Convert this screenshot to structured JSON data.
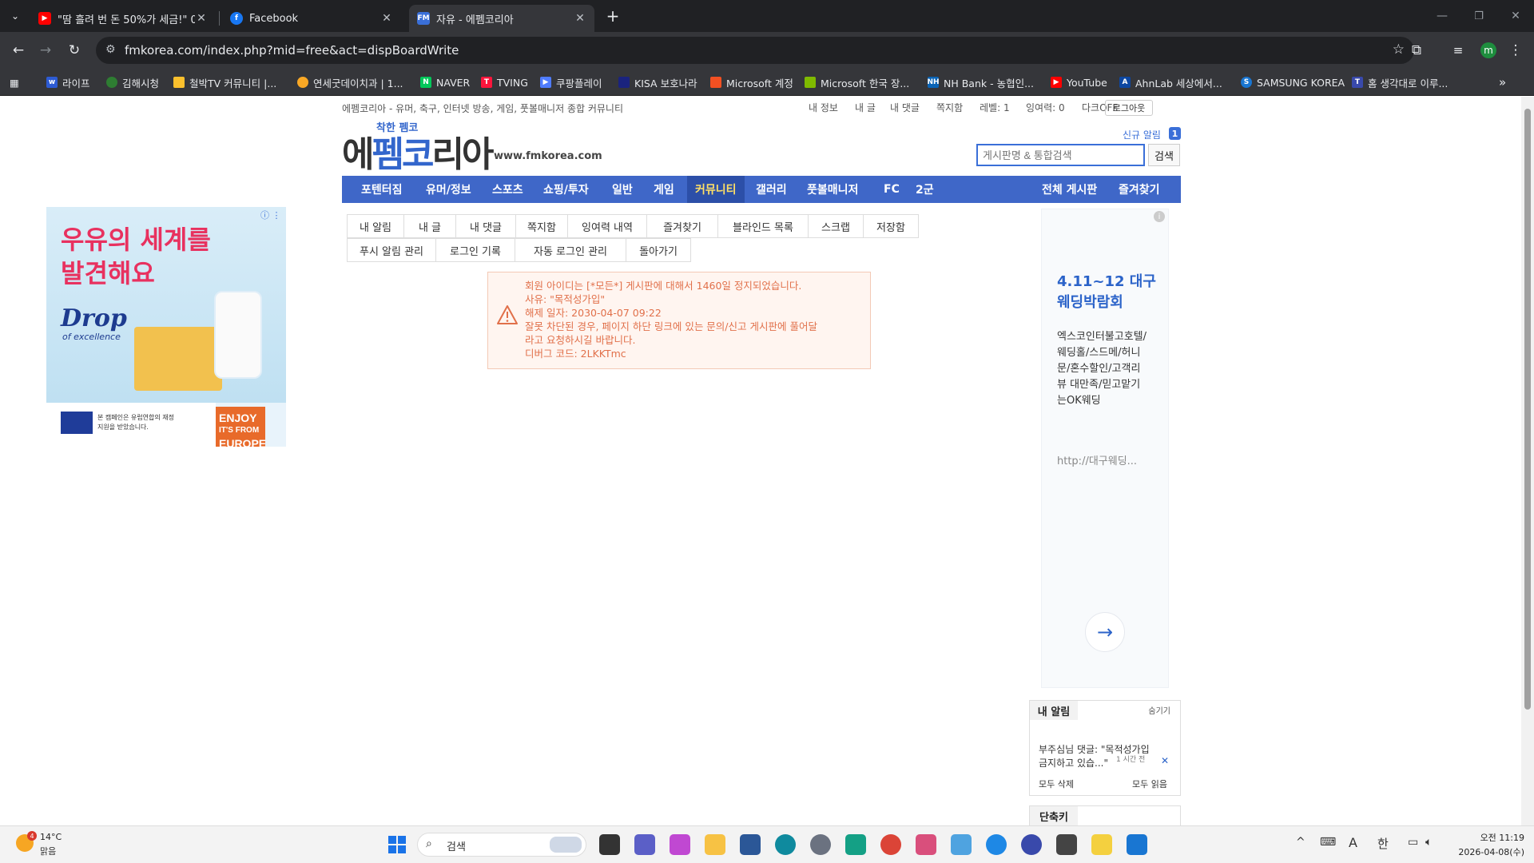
{
  "browser": {
    "tabs": [
      {
        "title": "\"땀 흘려 번 돈 50%가 세금!\" 0",
        "icon": "youtube-icon",
        "active": false
      },
      {
        "title": "Facebook",
        "icon": "facebook-icon",
        "active": false
      },
      {
        "title": "자유 - 에펨코리아",
        "icon": "fmkorea-icon",
        "active": true
      }
    ],
    "url": "fmkorea.com/index.php?mid=free&act=dispBoardWrite",
    "profile_initial": "m",
    "bookmarks": [
      {
        "label": "라이프",
        "color": "#2d5bd3"
      },
      {
        "label": "김해시청",
        "color": "#2e7d32"
      },
      {
        "label": "철박TV 커뮤니티 |...",
        "color": "#fbc02d"
      },
      {
        "label": "연세굿데이치과 | 1...",
        "color": "#f9a825"
      },
      {
        "label": "NAVER",
        "color": "#03c75a"
      },
      {
        "label": "TVING",
        "color": "#ff153c"
      },
      {
        "label": "쿠팡플레이",
        "color": "#4f7cff"
      },
      {
        "label": "KISA 보호나라",
        "color": "#1a237e"
      },
      {
        "label": "Microsoft 계정",
        "color": "#f25022"
      },
      {
        "label": "Microsoft 한국 장...",
        "color": "#7fba00"
      },
      {
        "label": "NH Bank - 농협인...",
        "color": "#0a64b6"
      },
      {
        "label": "YouTube",
        "color": "#ff0000"
      },
      {
        "label": "AhnLab 세상에서...",
        "color": "#0d47a1"
      },
      {
        "label": "SAMSUNG KOREA",
        "color": "#1976d2"
      },
      {
        "label": "홈 생각대로 이루...",
        "color": "#3949ab"
      }
    ]
  },
  "site": {
    "tagline": "에펨코리아 - 유머, 축구, 인터넷 방송, 게임, 풋볼매니저 종합 커뮤니티",
    "util_links": [
      "내 정보",
      "내 글",
      "내 댓글",
      "쪽지함",
      "레벨: 1",
      "잉여력: 0",
      "다크OFF"
    ],
    "logout": "로그아웃",
    "logo_main": "에펨코리아",
    "logo_sub": "착한 펨코",
    "logo_url": "www.fmkorea.com",
    "new_notif_label": "신규 알림",
    "new_notif_count": "1",
    "search_placeholder": "게시판명 & 통합검색",
    "search_button": "검색",
    "nav": [
      "포텐터짐",
      "유머/정보",
      "스포츠",
      "쇼핑/투자",
      "일반",
      "게임",
      "커뮤니티",
      "갤러리",
      "풋볼매니저",
      "FC",
      "2군"
    ],
    "nav_right": [
      "전체 게시판",
      "즐겨찾기"
    ],
    "subnav_row1": [
      "내 알림",
      "내 글",
      "내 댓글",
      "쪽지함",
      "잉여력 내역",
      "즐겨찾기",
      "블라인드 목록",
      "스크랩",
      "저장함"
    ],
    "subnav_row2": [
      "푸시 알림 관리",
      "로그인 기록",
      "자동 로그인 관리",
      "돌아가기"
    ],
    "error": [
      "회원 아이디는 [*모든*] 게시판에 대해서 1460일 정지되었습니다.",
      "사유: \"목적성가입\"",
      "해제 일자: 2030-04-07 09:22",
      "잘못 차단된 경우, 페이지 하단 링크에 있는 문의/신고 게시판에 풀어달",
      "라고 요청하시길 바랍니다.",
      "디버그 코드: 2LKKTmc"
    ]
  },
  "left_ad": {
    "headline1": "우유의 세계를",
    "headline2": "발견해요",
    "brand": "Drop",
    "brand_sub": "of excellence",
    "enjoy": [
      "ENJOY",
      "IT'S FROM",
      "EUROPE"
    ],
    "disclaimer1": "본 캠페인은 유럽연합의 재정",
    "disclaimer2": "지원을 받았습니다."
  },
  "right_ad": {
    "title1": "4.11~12 대구",
    "title2": "웨딩박람회",
    "body": [
      "엑스코인터불고호텔/",
      "웨딩홀/스드메/허니",
      "문/혼수할인/고객리",
      "뷰 대만족/믿고맡기",
      "는OK웨딩"
    ],
    "url": "http://대구웨딩..."
  },
  "notif_panel": {
    "title": "내 알림",
    "hide": "숨기기",
    "item1": "부주심님 댓글: \"목적성가입",
    "item2": "금지하고 있습...\"",
    "time": "1 시간 전",
    "delete_all": "모두 삭제",
    "read_all": "모두 읽음"
  },
  "shortcut_title": "단축키",
  "taskbar": {
    "weather_temp": "14°C",
    "weather_desc": "맑음",
    "weather_badge": "4",
    "search_label": "검색",
    "time": "오전 11:19",
    "date": "2026-04-08(수)",
    "ime_a": "A",
    "ime_han": "한"
  }
}
